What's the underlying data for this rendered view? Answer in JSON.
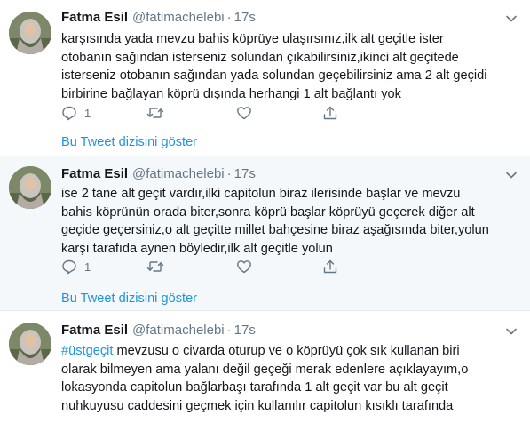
{
  "tweets": [
    {
      "name": "Fatma Esil",
      "handle": "@fatimachelebi",
      "separator": "·",
      "time": "17s",
      "lines": [
        "karşısında yada mevzu bahis köprüye ulaşırsınız,ilk alt geçitle ister",
        "otobanın sağından isterseniz solundan çıkabilirsiniz,ikinci alt geçitede",
        "isterseniz otobanın sağından yada solundan geçebilirsiniz ama 2 alt geçidi",
        "birbirine bağlayan köprü dışında herhangi 1 alt bağlantı yok"
      ],
      "reply_count": "1",
      "thread_link": "Bu Tweet dizisini göster"
    },
    {
      "name": "Fatma Esil",
      "handle": "@fatimachelebi",
      "separator": "·",
      "time": "17s",
      "lines": [
        "ise 2 tane alt geçit vardır,ilki capitolun biraz ilerisinde başlar ve mevzu",
        "bahis köprünün orada biter,sonra köprü başlar köprüyü geçerek diğer alt",
        "geçide geçersiniz,o alt geçitte millet bahçesine biraz aşağısında biter,yolun",
        "karşı tarafıda aynen böyledir,ilk alt geçitle yolun"
      ],
      "reply_count": "1",
      "thread_link": "Bu Tweet dizisini göster"
    },
    {
      "name": "Fatma Esil",
      "handle": "@fatimachelebi",
      "separator": "·",
      "time": "17s",
      "hashtag": "#üstgeçit",
      "first_line_rest": " mevzusu o civarda oturup ve o köprüyü çok sık kullanan biri",
      "lines": [
        "olarak bilmeyen ama yalanı değil geçeği merak edenlere açıklayayım,o",
        "lokasyonda capitolun bağlarbaşı tarafında 1 alt geçit var bu alt geçit",
        "nuhkuyusu caddesini geçmek için kullanılır capitolun kısıklı tarafında"
      ]
    }
  ],
  "icons": {
    "avatar": "profile-photo-hijab",
    "menu": "chevron-down-icon",
    "reply": "reply-icon",
    "retweet": "retweet-icon",
    "like": "heart-icon",
    "share": "share-icon"
  },
  "colors": {
    "link": "#1b95e0",
    "muted": "#657786",
    "text": "#14171a",
    "thread_bg": "#f5f8fa",
    "divider": "#e6ecf0"
  }
}
